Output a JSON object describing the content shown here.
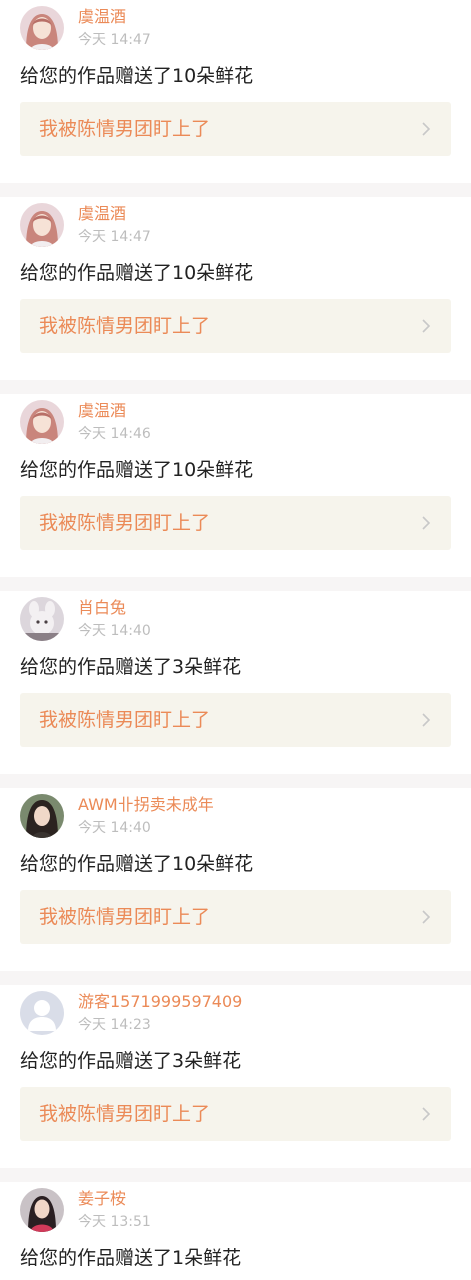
{
  "notifications": [
    {
      "username": "虞温酒",
      "time": "今天 14:47",
      "message": "给您的作品赠送了10朵鲜花",
      "work_title": "我被陈情男团盯上了",
      "avatar_icon": "avatar-girl-pink-hair"
    },
    {
      "username": "虞温酒",
      "time": "今天 14:47",
      "message": "给您的作品赠送了10朵鲜花",
      "work_title": "我被陈情男团盯上了",
      "avatar_icon": "avatar-girl-pink-hair"
    },
    {
      "username": "虞温酒",
      "time": "今天 14:46",
      "message": "给您的作品赠送了10朵鲜花",
      "work_title": "我被陈情男团盯上了",
      "avatar_icon": "avatar-girl-pink-hair"
    },
    {
      "username": "肖白兔",
      "time": "今天 14:40",
      "message": "给您的作品赠送了3朵鲜花",
      "work_title": "我被陈情男团盯上了",
      "avatar_icon": "avatar-plush-toy"
    },
    {
      "username": "AWM卝拐卖未成年",
      "time": "今天 14:40",
      "message": "给您的作品赠送了10朵鲜花",
      "work_title": "我被陈情男团盯上了",
      "avatar_icon": "avatar-girl-dark-hair"
    },
    {
      "username": "游客1571999597409",
      "time": "今天 14:23",
      "message": "给您的作品赠送了3朵鲜花",
      "work_title": "我被陈情男团盯上了",
      "avatar_icon": "avatar-default-guest"
    },
    {
      "username": "姜子桉",
      "time": "今天 13:51",
      "message": "给您的作品赠送了1朵鲜花",
      "work_title": "",
      "avatar_icon": "avatar-girl-red"
    }
  ],
  "colors": {
    "accent": "#eb8a57",
    "link_bg": "#f6f4ec",
    "time_text": "#bdbdbd",
    "body_text": "#222222",
    "separator": "#f7f5f5"
  }
}
